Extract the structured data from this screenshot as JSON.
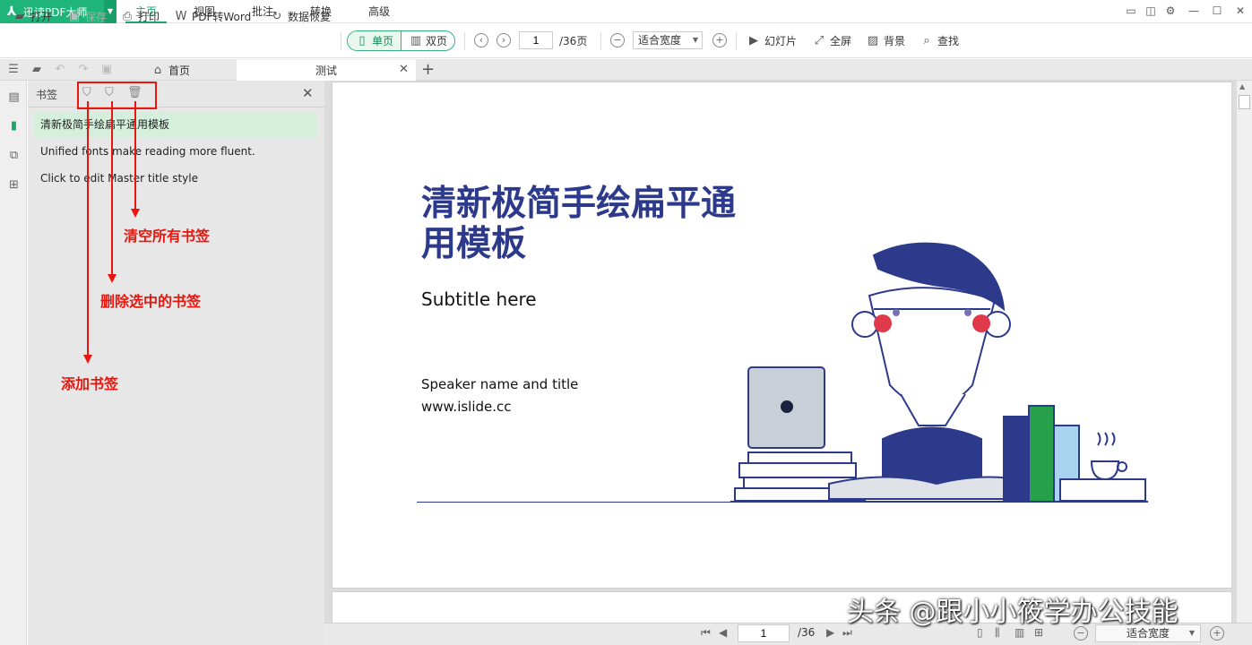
{
  "app": {
    "name": "迅读PDF大师"
  },
  "menu": [
    "主页",
    "视图",
    "批注",
    "转换",
    "高级"
  ],
  "toolbar": {
    "open": "打开",
    "save": "保存",
    "print": "打印",
    "pdf_to_word": "PDF转Word",
    "recover": "数据恢复",
    "single_page": "单页",
    "double_page": "双页",
    "page_current": "1",
    "page_total": "/36页",
    "zoom": "适合宽度",
    "slideshow": "幻灯片",
    "fullscreen": "全屏",
    "background": "背景",
    "find": "查找"
  },
  "tabs": {
    "home": "首页",
    "doc": "测试"
  },
  "bookmarks": {
    "title": "书签",
    "items": [
      "清新极简手绘扁平通用模板",
      "Unified fonts make reading more fluent.",
      "Click to edit Master title style"
    ]
  },
  "annotations": {
    "clear": "清空所有书签",
    "delete": "删除选中的书签",
    "add": "添加书签"
  },
  "slide": {
    "title_line1": "清新极简手绘扁平通",
    "title_line2": "用模板",
    "subtitle": "Subtitle here",
    "speaker": "Speaker name and title",
    "url": "www.islide.cc"
  },
  "statusbar": {
    "page_current": "1",
    "page_total": "/36",
    "zoom": "适合宽度"
  },
  "watermark": "头条 @跟小小筱学办公技能",
  "colors": {
    "brand": "#1fb57a",
    "annotation": "#e8160e",
    "slide_title": "#2d3a8c"
  }
}
